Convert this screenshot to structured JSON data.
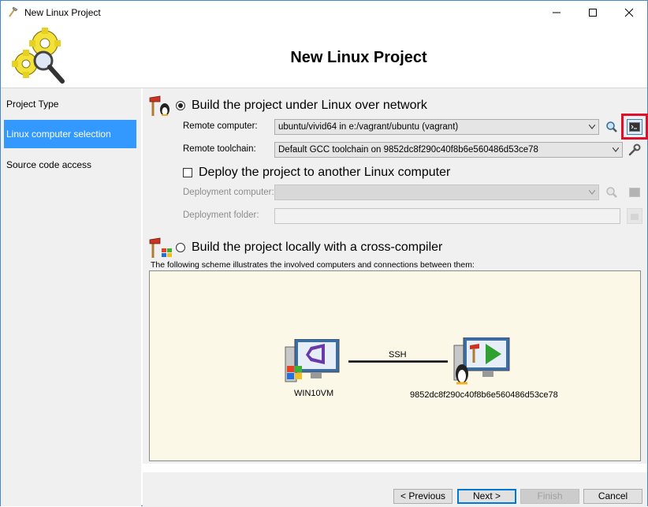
{
  "window": {
    "title": "New Linux Project",
    "controls": {
      "minimize": "minimize-icon",
      "maximize": "maximize-icon",
      "close": "close-icon"
    }
  },
  "header": {
    "heading": "New Linux Project",
    "logo_icon": "gears-magnifier-icon"
  },
  "nav": {
    "items": [
      {
        "label": "Project Type",
        "selected": false
      },
      {
        "label": "Linux computer selection",
        "selected": true
      },
      {
        "label": "Source code access",
        "selected": false
      }
    ]
  },
  "build_remote": {
    "label": "Build the project under Linux over network",
    "selected": true,
    "remote_computer_label": "Remote computer:",
    "remote_computer_value": "ubuntu/vivid64 in e:/vagrant/ubuntu (vagrant)",
    "remote_toolchain_label": "Remote toolchain:",
    "remote_toolchain_value": "Default GCC toolchain on 9852dc8f290c40f8b6e560486d53ce78"
  },
  "deploy": {
    "label": "Deploy the project to another Linux computer",
    "checked": false,
    "deployment_computer_label": "Deployment computer:",
    "deployment_computer_value": "",
    "deployment_folder_label": "Deployment folder:",
    "deployment_folder_value": ""
  },
  "build_local": {
    "label": "Build the project locally with a cross-compiler",
    "selected": false
  },
  "scheme": {
    "caption": "The following scheme illustrates the involved computers and connections between them:",
    "local_computer": "WIN10VM",
    "connection": "SSH",
    "remote_computer": "9852dc8f290c40f8b6e560486d53ce78"
  },
  "buttons": {
    "previous": "< Previous",
    "next": "Next >",
    "finish": "Finish",
    "cancel": "Cancel"
  },
  "colors": {
    "selection": "#3399ff",
    "highlight": "#e0102a",
    "scheme_background": "#fbf8e8"
  }
}
